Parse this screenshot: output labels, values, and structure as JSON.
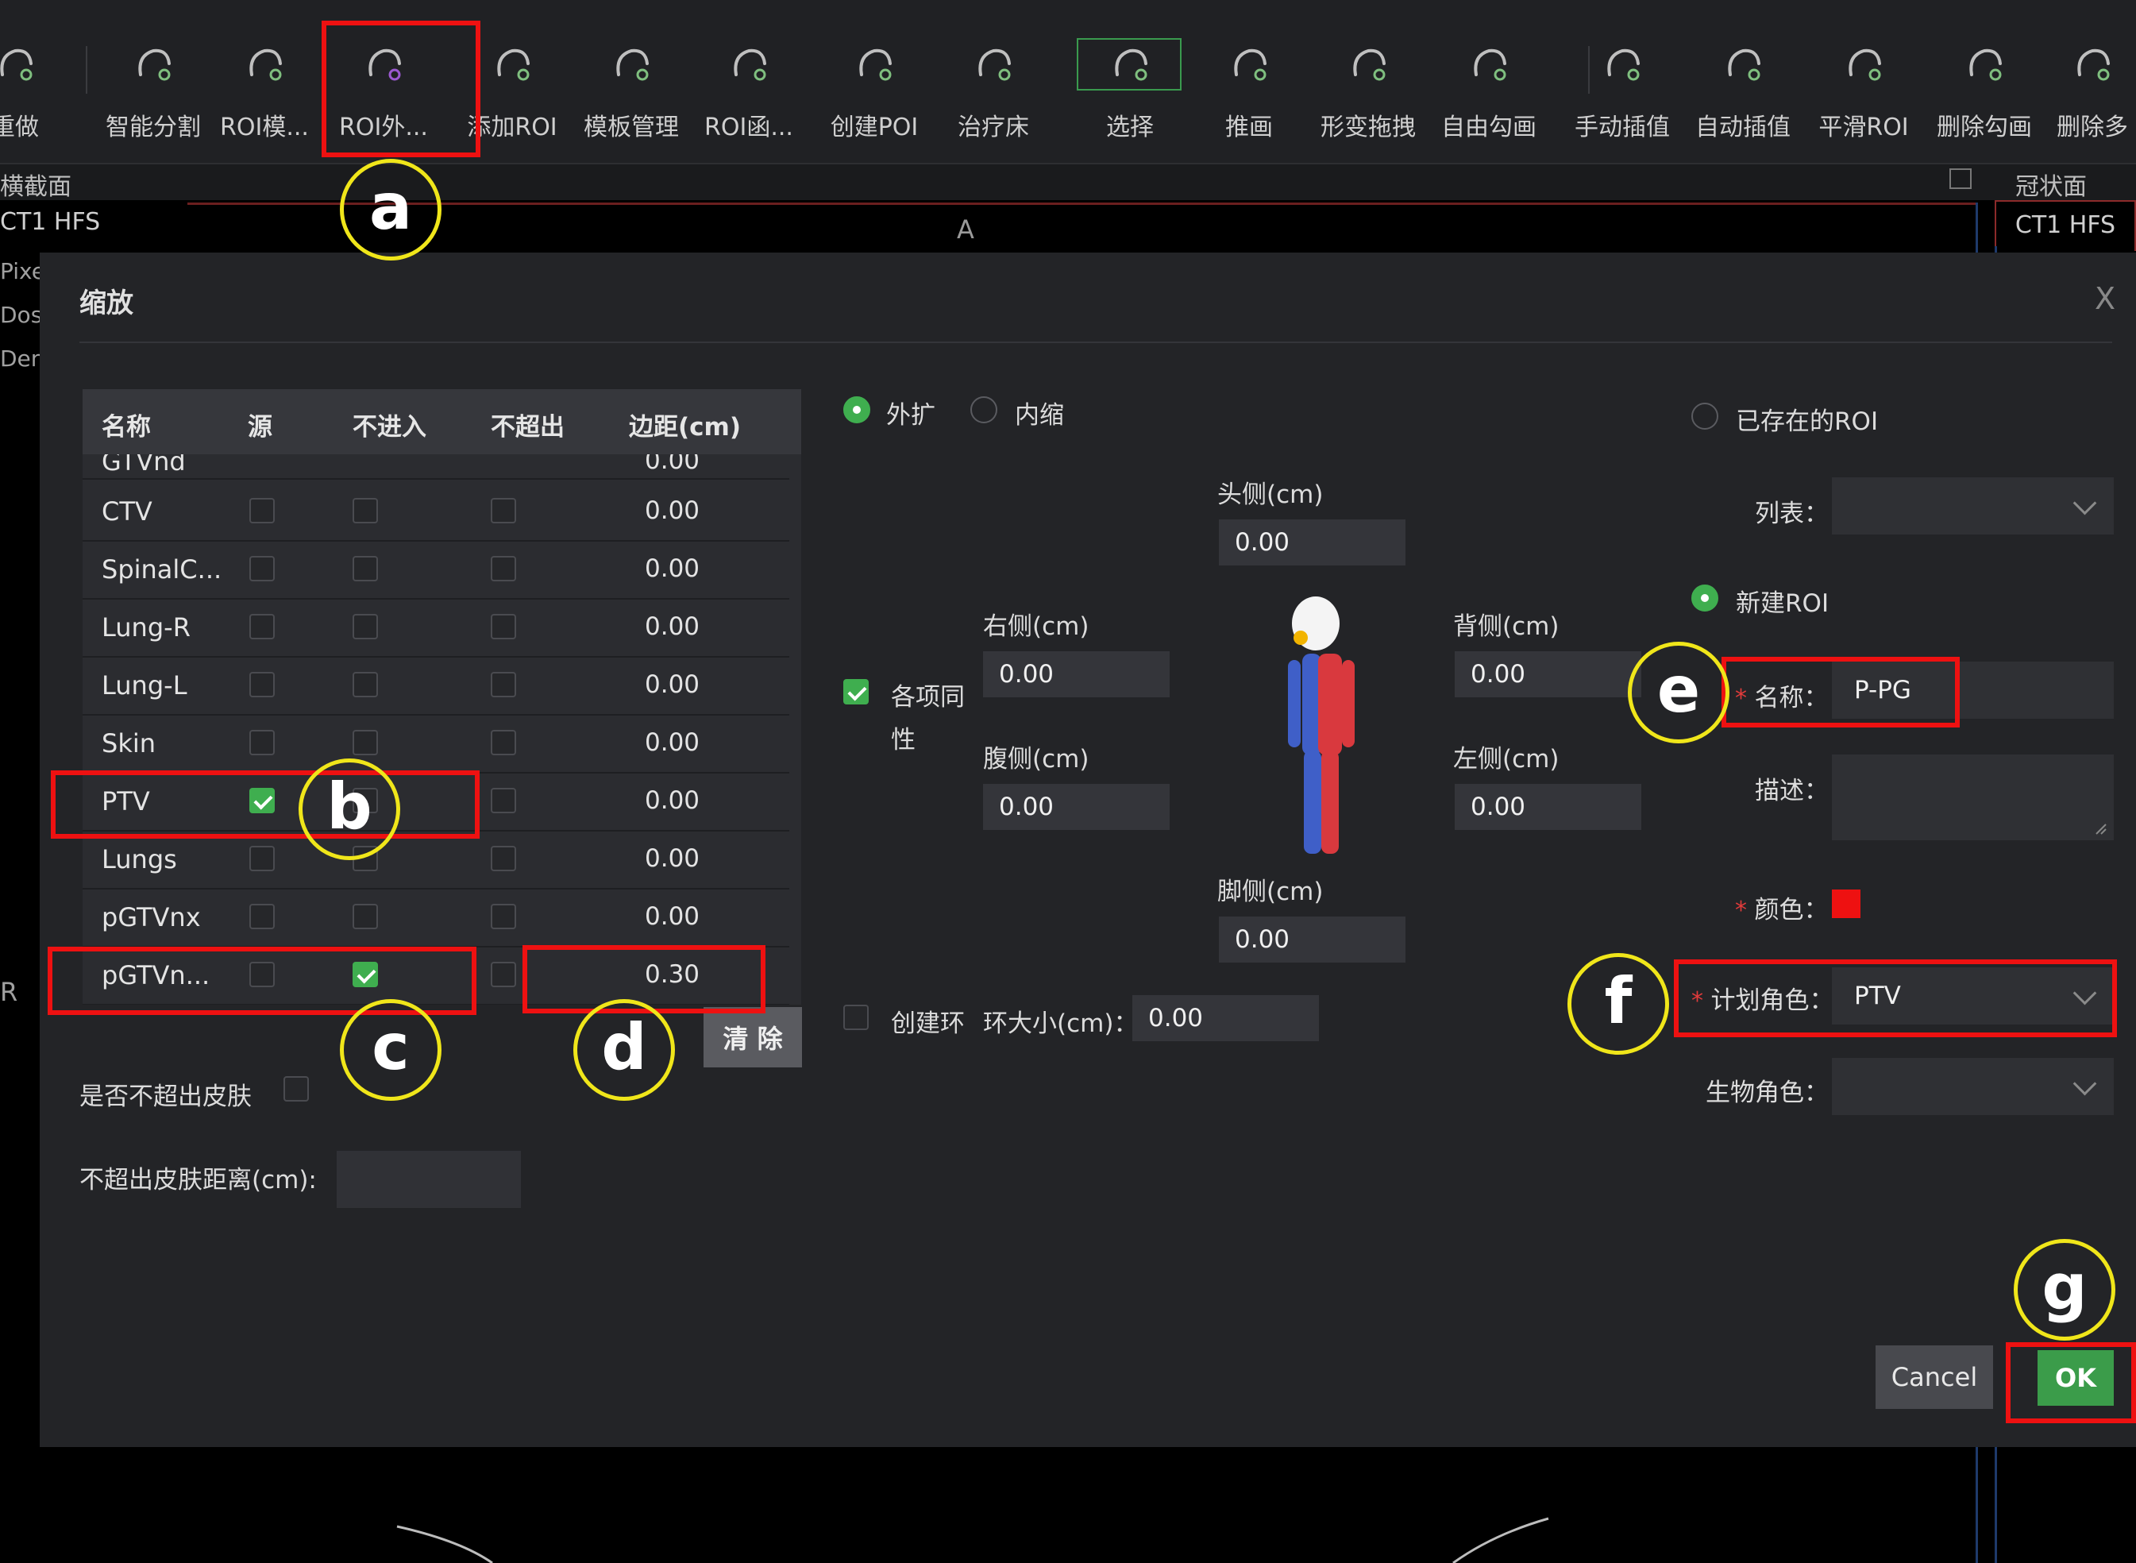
{
  "toolbar": {
    "items": [
      {
        "label": "重做",
        "icon": "redo-icon"
      },
      {
        "label": "智能分割",
        "icon": "smart-segment-icon"
      },
      {
        "label": "ROI模...",
        "icon": "roi-template-icon"
      },
      {
        "label": "ROI外...",
        "icon": "roi-expand-icon"
      },
      {
        "label": "添加ROI",
        "icon": "add-roi-icon"
      },
      {
        "label": "模板管理",
        "icon": "template-manage-icon"
      },
      {
        "label": "ROI函...",
        "icon": "roi-function-icon"
      },
      {
        "label": "创建POI",
        "icon": "create-poi-icon"
      },
      {
        "label": "治疗床",
        "icon": "couch-icon"
      },
      {
        "label": "选择",
        "icon": "select-cursor-icon"
      },
      {
        "label": "推画",
        "icon": "push-draw-icon"
      },
      {
        "label": "形变拖拽",
        "icon": "deform-drag-icon"
      },
      {
        "label": "自由勾画",
        "icon": "free-draw-icon"
      },
      {
        "label": "手动插值",
        "icon": "manual-interp-icon"
      },
      {
        "label": "自动插值",
        "icon": "auto-interp-icon"
      },
      {
        "label": "平滑ROI",
        "icon": "smooth-roi-icon"
      },
      {
        "label": "删除勾画",
        "icon": "delete-contour-icon"
      },
      {
        "label": "删除多",
        "icon": "delete-multi-icon"
      }
    ]
  },
  "views": {
    "left_title": "横截面",
    "right_title": "冠状面",
    "left_tab": "CT1 HFS",
    "right_tab": "CT1 HFS",
    "axis_a": "A",
    "side_labels": [
      "Pixel",
      "Dose",
      "Dens"
    ],
    "side_r": "R"
  },
  "dialog": {
    "title": "缩放",
    "close": "X",
    "table": {
      "headers": [
        "名称",
        "源",
        "不进入",
        "不超出",
        "边距(cm)"
      ],
      "partial_row": {
        "name": "GTVnd",
        "margin": "0.00"
      },
      "rows": [
        {
          "name": "CTV",
          "src": false,
          "noenter": false,
          "noexceed": false,
          "margin": "0.00"
        },
        {
          "name": "SpinalC...",
          "src": false,
          "noenter": false,
          "noexceed": false,
          "margin": "0.00"
        },
        {
          "name": "Lung-R",
          "src": false,
          "noenter": false,
          "noexceed": false,
          "margin": "0.00"
        },
        {
          "name": "Lung-L",
          "src": false,
          "noenter": false,
          "noexceed": false,
          "margin": "0.00"
        },
        {
          "name": "Skin",
          "src": false,
          "noenter": false,
          "noexceed": false,
          "margin": "0.00"
        },
        {
          "name": "PTV",
          "src": true,
          "noenter": false,
          "noexceed": false,
          "margin": "0.00"
        },
        {
          "name": "Lungs",
          "src": false,
          "noenter": false,
          "noexceed": false,
          "margin": "0.00"
        },
        {
          "name": "pGTVnx",
          "src": false,
          "noenter": false,
          "noexceed": false,
          "margin": "0.00"
        },
        {
          "name": "pGTVn...",
          "src": false,
          "noenter": true,
          "noexceed": false,
          "margin": "0.30"
        }
      ]
    },
    "clear_label": "清 除",
    "skin_no_exceed_label": "是否不超出皮肤",
    "skin_distance_label": "不超出皮肤距离(cm):",
    "mode": {
      "expand": "外扩",
      "shrink": "内缩"
    },
    "uniform_label_1": "各项同",
    "uniform_label_2": "性",
    "directions": {
      "head": {
        "label": "头侧(cm)",
        "value": "0.00"
      },
      "right": {
        "label": "右侧(cm)",
        "value": "0.00"
      },
      "back": {
        "label": "背侧(cm)",
        "value": "0.00"
      },
      "belly": {
        "label": "腹侧(cm)",
        "value": "0.00"
      },
      "left": {
        "label": "左侧(cm)",
        "value": "0.00"
      },
      "foot": {
        "label": "脚侧(cm)",
        "value": "0.00"
      }
    },
    "ring": {
      "label": "创建环",
      "size_label": "环大小(cm)：",
      "size_value": "0.00"
    },
    "right": {
      "existing_roi": "已存在的ROI",
      "list_label": "列表：",
      "new_roi": "新建ROI",
      "name_label": "名称：",
      "name_value": "P-PG",
      "desc_label": "描述：",
      "color_label": "颜色：",
      "color_value": "#ee1111",
      "plan_role_label": "计划角色：",
      "plan_role_value": "PTV",
      "bio_role_label": "生物角色："
    },
    "cancel_label": "Cancel",
    "ok_label": "OK"
  },
  "annotations": [
    "a",
    "b",
    "c",
    "d",
    "e",
    "f",
    "g"
  ],
  "colors": {
    "accent_green": "#3fae4f",
    "annotation_red": "#ee1111",
    "annotation_yellow": "#f0e61a"
  }
}
